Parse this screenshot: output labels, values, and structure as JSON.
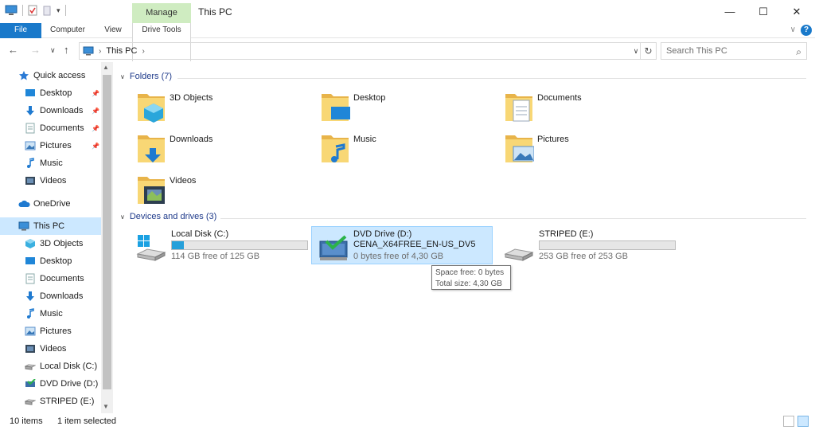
{
  "window": {
    "title": "This PC",
    "manage_label": "Manage",
    "minimize": "—",
    "maximize": "☐",
    "close": "✕"
  },
  "ribbon": {
    "tabs": [
      "File",
      "Computer",
      "View",
      "Drive Tools"
    ],
    "help": "?"
  },
  "address": {
    "path": [
      "This PC"
    ],
    "search_placeholder": "Search This PC"
  },
  "sidebar": {
    "items": [
      {
        "label": "Quick access",
        "icon": "star-icon",
        "pinned": false,
        "level": 0
      },
      {
        "label": "Desktop",
        "icon": "desktop-icon",
        "pinned": true,
        "level": 1
      },
      {
        "label": "Downloads",
        "icon": "download-icon",
        "pinned": true,
        "level": 1
      },
      {
        "label": "Documents",
        "icon": "document-icon",
        "pinned": true,
        "level": 1
      },
      {
        "label": "Pictures",
        "icon": "pictures-icon",
        "pinned": true,
        "level": 1
      },
      {
        "label": "Music",
        "icon": "music-icon",
        "pinned": false,
        "level": 1
      },
      {
        "label": "Videos",
        "icon": "video-icon",
        "pinned": false,
        "level": 1
      },
      {
        "label": "OneDrive",
        "icon": "cloud-icon",
        "pinned": false,
        "level": 0
      },
      {
        "label": "This PC",
        "icon": "computer-icon",
        "pinned": false,
        "level": 0,
        "selected": true
      },
      {
        "label": "3D Objects",
        "icon": "cube-icon",
        "pinned": false,
        "level": 1
      },
      {
        "label": "Desktop",
        "icon": "desktop-icon",
        "pinned": false,
        "level": 1
      },
      {
        "label": "Documents",
        "icon": "document-icon",
        "pinned": false,
        "level": 1
      },
      {
        "label": "Downloads",
        "icon": "download-icon",
        "pinned": false,
        "level": 1
      },
      {
        "label": "Music",
        "icon": "music-icon",
        "pinned": false,
        "level": 1
      },
      {
        "label": "Pictures",
        "icon": "pictures-icon",
        "pinned": false,
        "level": 1
      },
      {
        "label": "Videos",
        "icon": "video-icon",
        "pinned": false,
        "level": 1
      },
      {
        "label": "Local Disk (C:)",
        "icon": "hard-drive-icon",
        "pinned": false,
        "level": 1
      },
      {
        "label": "DVD Drive (D:) C",
        "icon": "dvd-icon",
        "pinned": false,
        "level": 1
      },
      {
        "label": "STRIPED (E:)",
        "icon": "hard-drive-icon",
        "pinned": false,
        "level": 1
      }
    ]
  },
  "folders": {
    "header": "Folders (7)",
    "items": [
      {
        "label": "3D Objects",
        "icon": "cube-folder-icon"
      },
      {
        "label": "Desktop",
        "icon": "desktop-folder-icon"
      },
      {
        "label": "Documents",
        "icon": "documents-folder-icon"
      },
      {
        "label": "Downloads",
        "icon": "downloads-folder-icon"
      },
      {
        "label": "Music",
        "icon": "music-folder-icon"
      },
      {
        "label": "Pictures",
        "icon": "pictures-folder-icon"
      },
      {
        "label": "Videos",
        "icon": "videos-folder-icon"
      }
    ]
  },
  "drives": {
    "header": "Devices and drives (3)",
    "items": [
      {
        "name": "Local Disk (C:)",
        "free_text": "114 GB free of 125 GB",
        "used_fraction": 0.088,
        "icon": "windows-drive-icon",
        "selected": false
      },
      {
        "name": "DVD Drive (D:)",
        "sublabel": "CENA_X64FREE_EN-US_DV5",
        "free_text": "0 bytes free of 4,30 GB",
        "icon": "dvd-drive-icon",
        "selected": true
      },
      {
        "name": "STRIPED (E:)",
        "free_text": "253 GB free of 253 GB",
        "used_fraction": 0.0,
        "icon": "hard-drive-icon",
        "selected": false
      }
    ]
  },
  "tooltip": {
    "line1": "Space free: 0 bytes",
    "line2": "Total size: 4,30 GB"
  },
  "status": {
    "items": "10 items",
    "selected": "1 item selected"
  },
  "colors": {
    "accent": "#1979ca",
    "selection": "#cce8ff",
    "manage": "#cfecc1",
    "bar_fill": "#26a0da"
  }
}
